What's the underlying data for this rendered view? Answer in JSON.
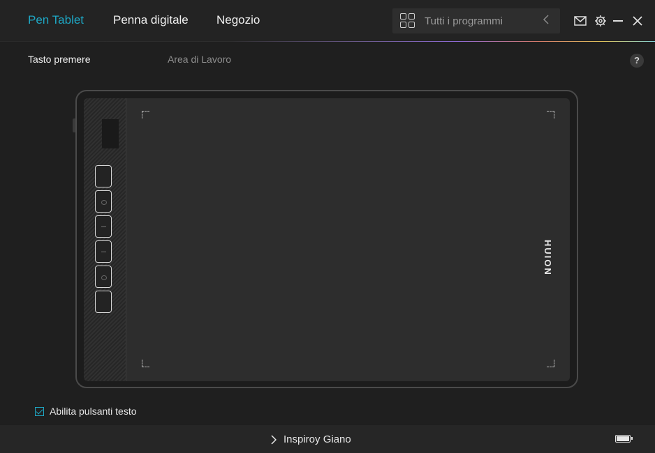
{
  "header": {
    "tabs": [
      {
        "label": "Pen Tablet",
        "active": true
      },
      {
        "label": "Penna digitale",
        "active": false
      },
      {
        "label": "Negozio",
        "active": false
      }
    ],
    "programs": {
      "label": "Tutti i programmi",
      "icon": "grid-icon",
      "arrow_icon": "chevron-left-icon"
    },
    "window_icons": [
      "mail-icon",
      "gear-icon",
      "minimize-icon",
      "close-icon"
    ]
  },
  "subnav": {
    "items": [
      {
        "label": "Tasto premere",
        "active": true
      },
      {
        "label": "Area di Lavoro",
        "active": false
      }
    ],
    "help_label": "?"
  },
  "tablet": {
    "brand": "HUION",
    "express_keys_count": 6
  },
  "options": {
    "enable_text_buttons": {
      "label": "Abilita pulsanti testo",
      "checked": true
    }
  },
  "footer": {
    "device_name": "Inspiroy Giano",
    "battery_icon": "battery-full-icon"
  },
  "colors": {
    "accent": "#1ea7c4",
    "background": "#1f1f1f",
    "topbar": "#232323"
  }
}
